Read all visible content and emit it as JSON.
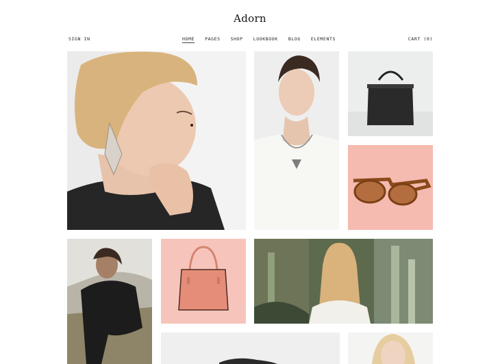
{
  "site": {
    "logo": "Adorn"
  },
  "nav": {
    "sign_in": "SIGN IN",
    "items": [
      "HOME",
      "PAGES",
      "SHOP",
      "LOOKBOOK",
      "BLOG",
      "ELEMENTS"
    ],
    "active": "HOME",
    "cart": "CART (0)"
  },
  "colors": {
    "background": "#ffffff",
    "pink_tile": "#f5bab0",
    "pink_tile_light": "#f7c4bb",
    "gray_tile": "#eceded",
    "text": "#222222"
  },
  "gallery": [
    {
      "subject": "model-earring"
    },
    {
      "subject": "model-necklace"
    },
    {
      "subject": "black-handbag"
    },
    {
      "subject": "sunglasses"
    },
    {
      "subject": "model-black-top"
    },
    {
      "subject": "pink-handbag"
    },
    {
      "subject": "model-cactus"
    },
    {
      "subject": "product-partial"
    },
    {
      "subject": "model-blonde-partial"
    }
  ]
}
